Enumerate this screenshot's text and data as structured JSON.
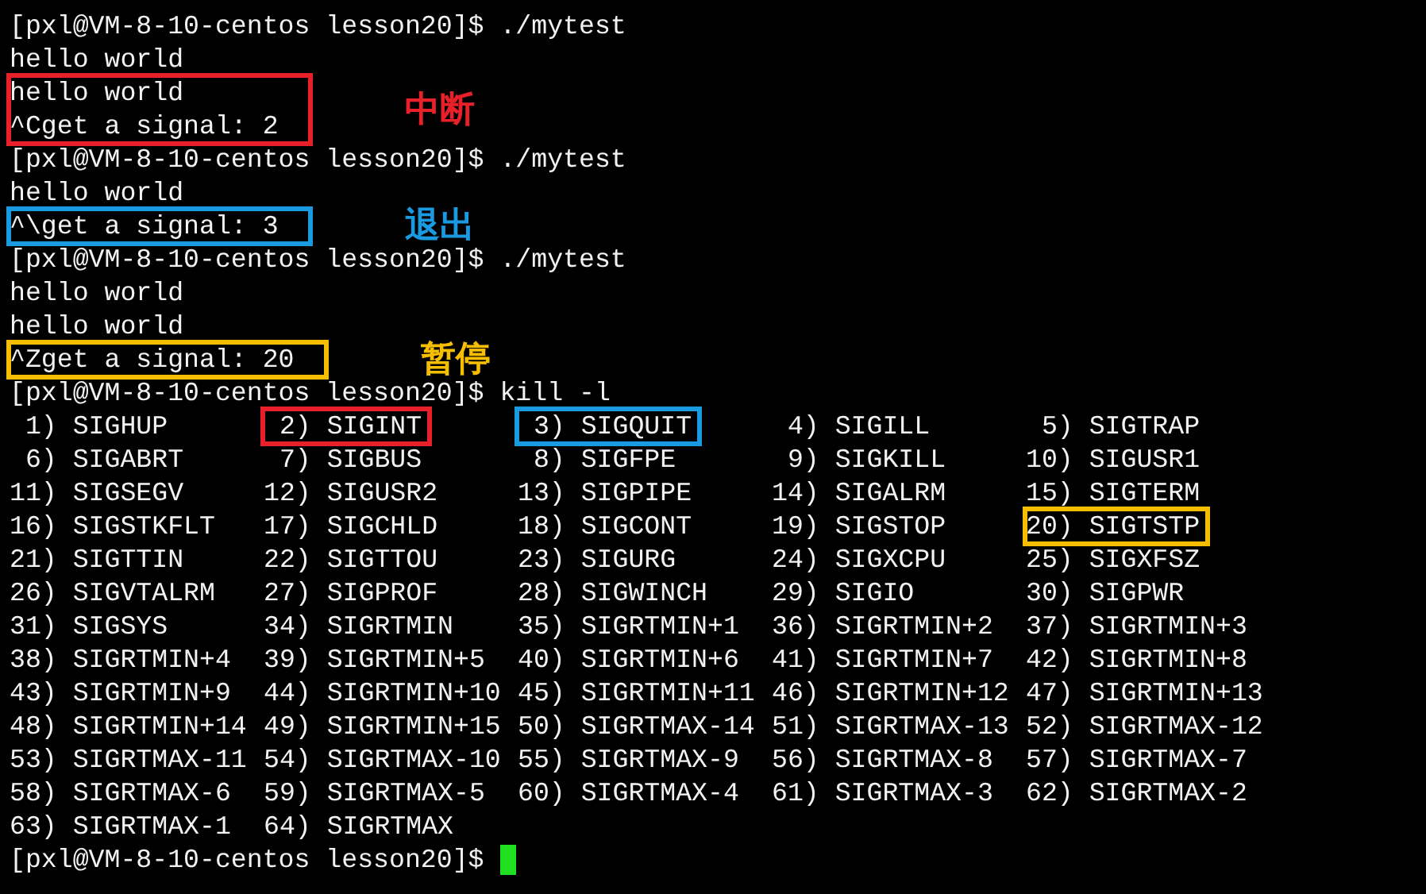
{
  "terminal": {
    "blocks": [
      {
        "lines": [
          "[pxl@VM-8-10-centos lesson20]$ ./mytest",
          "hello world"
        ]
      },
      {
        "lines": [
          "hello world",
          "^Cget a signal: 2"
        ],
        "color": "#e8202a",
        "note": "中断"
      },
      {
        "lines": [
          "[pxl@VM-8-10-centos lesson20]$ ./mytest",
          "hello world"
        ]
      },
      {
        "lines": [
          "^\\get a signal: 3"
        ],
        "color": "#1a9ae0",
        "note": "退出"
      },
      {
        "lines": [
          "[pxl@VM-8-10-centos lesson20]$ ./mytest",
          "hello world",
          "hello world"
        ]
      },
      {
        "lines": [
          "^Zget a signal: 20"
        ],
        "color": "#f5be00",
        "note": "暂停"
      },
      {
        "lines": [
          "[pxl@VM-8-10-centos lesson20]$ kill -l"
        ]
      }
    ],
    "signals": [
      {
        "text": "1) SIGHUP"
      },
      {
        "text": "2) SIGINT",
        "color": "#e8202a"
      },
      {
        "text": "3) SIGQUIT",
        "color": "#1a9ae0"
      },
      {
        "text": "4) SIGILL"
      },
      {
        "text": "5) SIGTRAP"
      },
      {
        "text": "6) SIGABRT"
      },
      {
        "text": "7) SIGBUS"
      },
      {
        "text": "8) SIGFPE"
      },
      {
        "text": "9) SIGKILL"
      },
      {
        "text": "10) SIGUSR1"
      },
      {
        "text": "11) SIGSEGV"
      },
      {
        "text": "12) SIGUSR2"
      },
      {
        "text": "13) SIGPIPE"
      },
      {
        "text": "14) SIGALRM"
      },
      {
        "text": "15) SIGTERM"
      },
      {
        "text": "16) SIGSTKFLT"
      },
      {
        "text": "17) SIGCHLD"
      },
      {
        "text": "18) SIGCONT"
      },
      {
        "text": "19) SIGSTOP"
      },
      {
        "text": "20) SIGTSTP",
        "color": "#f5be00"
      },
      {
        "text": "21) SIGTTIN"
      },
      {
        "text": "22) SIGTTOU"
      },
      {
        "text": "23) SIGURG"
      },
      {
        "text": "24) SIGXCPU"
      },
      {
        "text": "25) SIGXFSZ"
      },
      {
        "text": "26) SIGVTALRM"
      },
      {
        "text": "27) SIGPROF"
      },
      {
        "text": "28) SIGWINCH"
      },
      {
        "text": "29) SIGIO"
      },
      {
        "text": "30) SIGPWR"
      },
      {
        "text": "31) SIGSYS"
      },
      {
        "text": "34) SIGRTMIN"
      },
      {
        "text": "35) SIGRTMIN+1"
      },
      {
        "text": "36) SIGRTMIN+2"
      },
      {
        "text": "37) SIGRTMIN+3"
      },
      {
        "text": "38) SIGRTMIN+4"
      },
      {
        "text": "39) SIGRTMIN+5"
      },
      {
        "text": "40) SIGRTMIN+6"
      },
      {
        "text": "41) SIGRTMIN+7"
      },
      {
        "text": "42) SIGRTMIN+8"
      },
      {
        "text": "43) SIGRTMIN+9"
      },
      {
        "text": "44) SIGRTMIN+10"
      },
      {
        "text": "45) SIGRTMIN+11"
      },
      {
        "text": "46) SIGRTMIN+12"
      },
      {
        "text": "47) SIGRTMIN+13"
      },
      {
        "text": "48) SIGRTMIN+14"
      },
      {
        "text": "49) SIGRTMIN+15"
      },
      {
        "text": "50) SIGRTMAX-14"
      },
      {
        "text": "51) SIGRTMAX-13"
      },
      {
        "text": "52) SIGRTMAX-12"
      },
      {
        "text": "53) SIGRTMAX-11"
      },
      {
        "text": "54) SIGRTMAX-10"
      },
      {
        "text": "55) SIGRTMAX-9"
      },
      {
        "text": "56) SIGRTMAX-8"
      },
      {
        "text": "57) SIGRTMAX-7"
      },
      {
        "text": "58) SIGRTMAX-6"
      },
      {
        "text": "59) SIGRTMAX-5"
      },
      {
        "text": "60) SIGRTMAX-4"
      },
      {
        "text": "61) SIGRTMAX-3"
      },
      {
        "text": "62) SIGRTMAX-2"
      },
      {
        "text": "63) SIGRTMAX-1"
      },
      {
        "text": "64) SIGRTMAX"
      }
    ],
    "prompt": "[pxl@VM-8-10-centos lesson20]$"
  }
}
